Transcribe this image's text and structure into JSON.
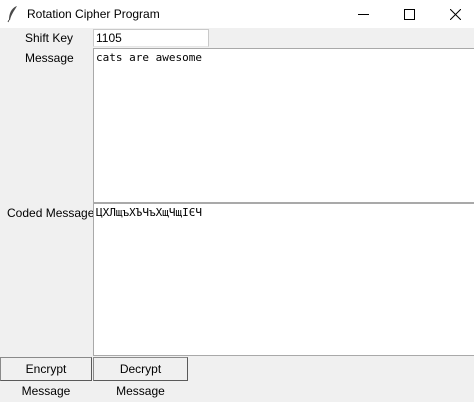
{
  "window": {
    "title": "Rotation Cipher Program",
    "icon": "feather-icon"
  },
  "form": {
    "shift_label": "Shift Key",
    "shift_value": "1105",
    "message_label": "Message",
    "message_value": "cats are awesome",
    "coded_label": "Coded Message",
    "coded_value": "ЦХЛщъХЪЧъХщЧщІЄЧ"
  },
  "buttons": {
    "encrypt": "Encrypt Message",
    "decrypt": "Decrypt Message"
  }
}
